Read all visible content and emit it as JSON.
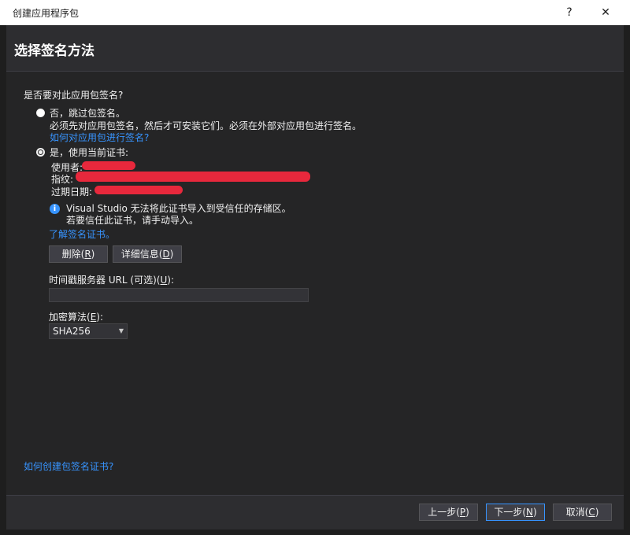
{
  "window": {
    "title": "创建应用程序包",
    "help_label": "?",
    "close_label": "✕"
  },
  "header": {
    "title": "选择签名方法"
  },
  "content": {
    "question": "是否要对此应用包签名?",
    "option_no": {
      "label": "否，跳过包签名。",
      "desc": "必须先对应用包签名，然后才可安装它们。必须在外部对应用包进行签名。",
      "link": "如何对应用包进行签名?"
    },
    "option_yes": {
      "label": "是，使用当前证书:"
    },
    "certificate": {
      "user_label": "使用者:",
      "thumbprint_label": "指纹:",
      "expiry_label": "过期日期:"
    },
    "info": {
      "line1": "Visual Studio 无法将此证书导入到受信任的存储区。",
      "line2": "若要信任此证书，请手动导入。"
    },
    "learn_link": "了解签名证书。",
    "delete_button": {
      "text": "删除(",
      "key": "R",
      "end": ")"
    },
    "details_button": {
      "text": "详细信息(",
      "key": "D",
      "end": ")"
    },
    "timestamp": {
      "label": "时间戳服务器 URL (可选)(",
      "key": "U",
      "end": "):",
      "value": ""
    },
    "algorithm": {
      "label": "加密算法(",
      "key": "E",
      "end": "):",
      "selected": "SHA256"
    },
    "bottom_link": "如何创建包签名证书?"
  },
  "footer": {
    "back_button": {
      "text": "上一步(",
      "key": "P",
      "end": ")"
    },
    "next_button": {
      "text": "下一步(",
      "key": "N",
      "end": ")"
    },
    "cancel_button": {
      "text": "取消(",
      "key": "C",
      "end": ")"
    }
  },
  "colors": {
    "accent": "#3794ff",
    "background": "#252526",
    "redaction": "#e8283c"
  }
}
